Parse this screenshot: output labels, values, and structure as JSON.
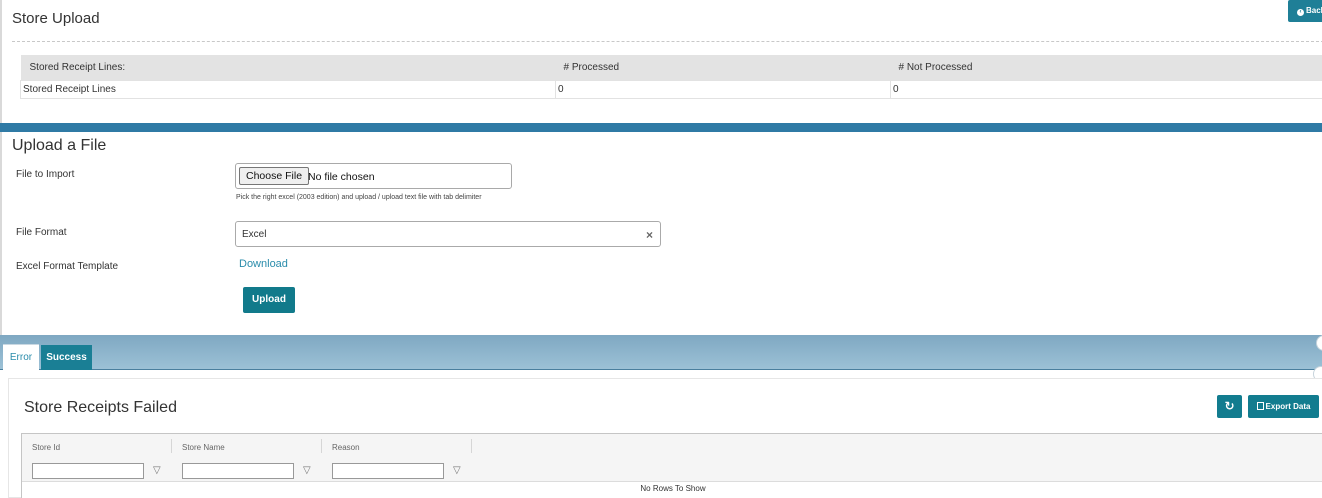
{
  "header": {
    "title": "Store Upload",
    "back_label": "Back"
  },
  "summary": {
    "columns": [
      "Stored Receipt Lines:",
      "# Processed",
      "# Not Processed"
    ],
    "row": [
      "Stored Receipt Lines",
      "0",
      "0"
    ]
  },
  "upload": {
    "title": "Upload a File",
    "file_label": "File to Import",
    "choose_label": "Choose File",
    "no_file": "No file chosen",
    "hint": "Pick the right excel (2003 edition) and upload / upload text file with tab delimiter",
    "format_label": "File Format",
    "format_value": "Excel",
    "template_label": "Excel Format Template",
    "download_label": "Download",
    "upload_button": "Upload"
  },
  "tabs": [
    {
      "label": "Error",
      "active": true
    },
    {
      "label": "Success",
      "active": false
    }
  ],
  "grid": {
    "title": "Store Receipts Failed",
    "export_label": "Export Data",
    "columns": [
      "Store Id",
      "Store Name",
      "Reason"
    ],
    "empty_text": "No Rows To Show"
  },
  "colors": {
    "accent": "#127c8f",
    "band": "#2f7aa5",
    "link": "#2a8cab"
  }
}
